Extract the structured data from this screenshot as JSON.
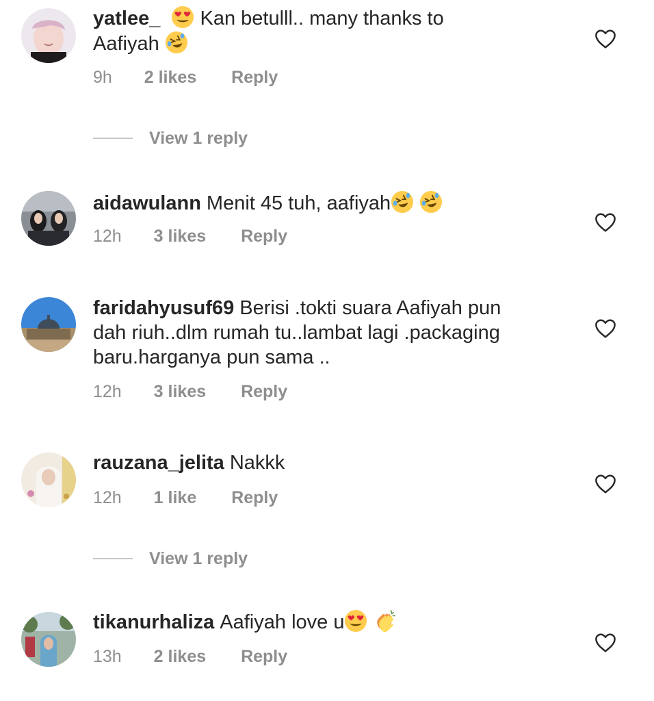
{
  "comments": [
    {
      "username": "yatlee_",
      "text_a": "Kan betulll.. many thanks to",
      "text_b": "Aafiyah",
      "time": "9h",
      "likes": "2 likes",
      "reply": "Reply",
      "view_replies": "View 1 reply"
    },
    {
      "username": "aidawulann",
      "text": "Menit 45 tuh, aafiyah",
      "time": "12h",
      "likes": "3 likes",
      "reply": "Reply"
    },
    {
      "username": "faridahyusuf69",
      "text_line1": "Berisi .tokti suara Aafiyah pun",
      "text_line2": "dah riuh..dlm rumah tu..lambat lagi .packaging",
      "text_line3": "baru.harganya pun sama ..",
      "time": "12h",
      "likes": "3 likes",
      "reply": "Reply"
    },
    {
      "username": "rauzana_jelita",
      "text": "Nakkk",
      "time": "12h",
      "likes": "1 like",
      "reply": "Reply",
      "view_replies": "View 1 reply"
    },
    {
      "username": "tikanurhaliza",
      "text": "Aafiyah love u",
      "time": "13h",
      "likes": "2 likes",
      "reply": "Reply"
    }
  ],
  "icons": {
    "like": "heart-outline-icon",
    "emoji_love": "heart-eyes-emoji",
    "emoji_laugh": "rolling-laughing-emoji",
    "emoji_clap": "clapping-hands-emoji"
  },
  "colors": {
    "text": "#262626",
    "secondary": "#8e8e8e",
    "divider": "#c7c7c7"
  }
}
